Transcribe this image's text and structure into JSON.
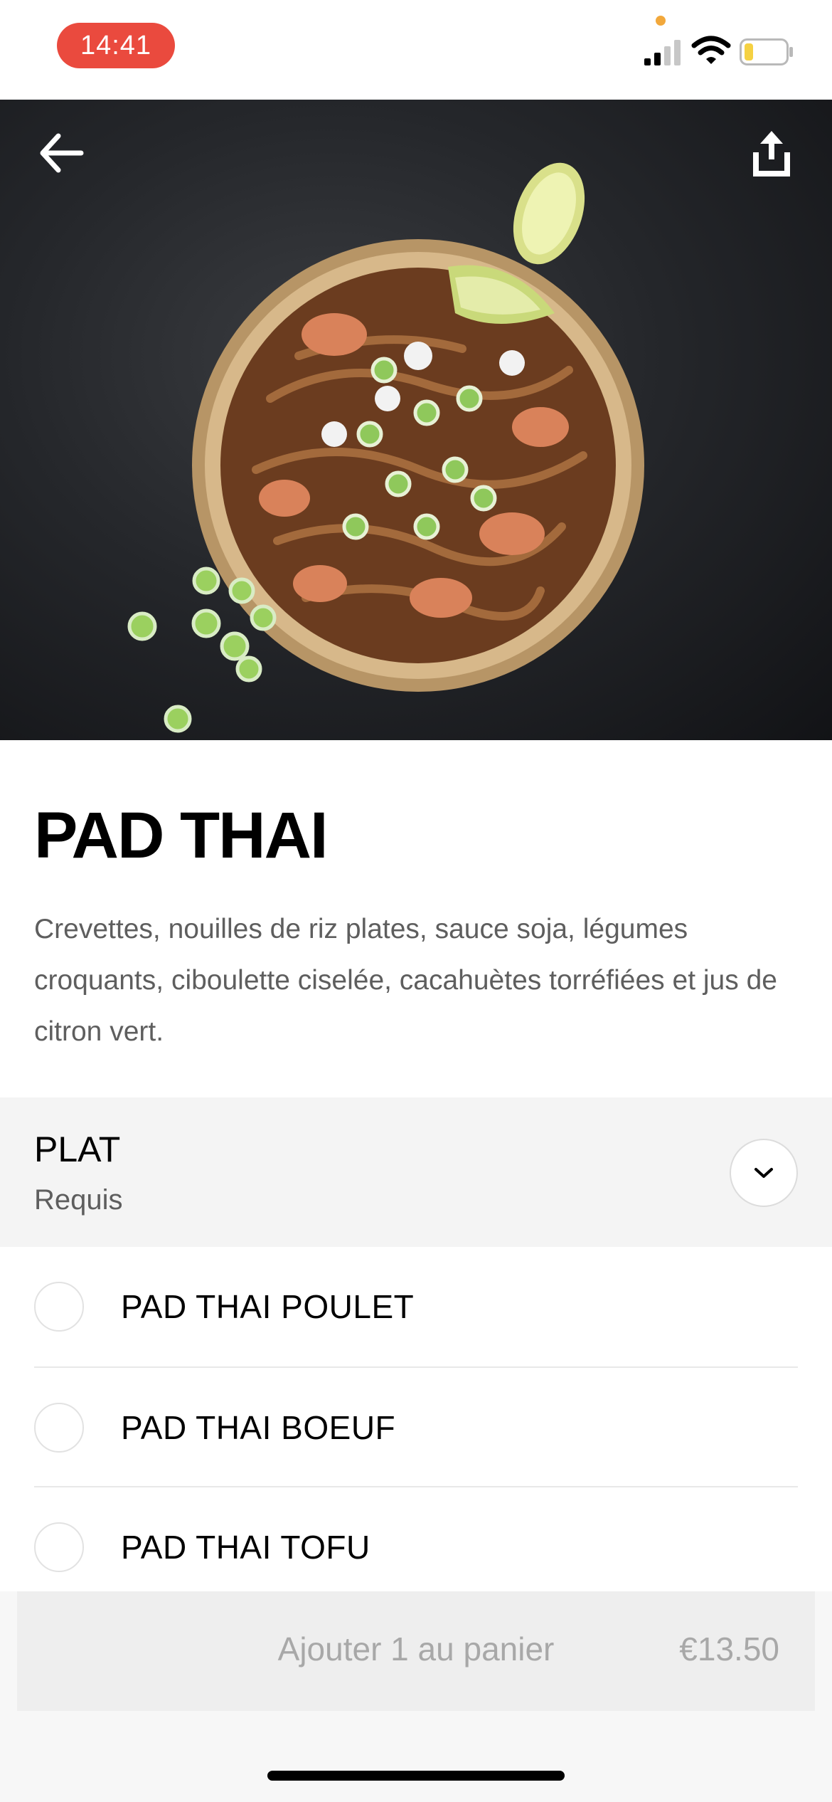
{
  "status_bar": {
    "time": "14:41",
    "icons": [
      "privacy-dot",
      "cellular-signal-icon",
      "wifi-icon",
      "battery-low-icon"
    ],
    "time_pill_color": "#ea4a3e",
    "battery_color": "#f5d142"
  },
  "hero": {
    "image": "pad-thai-bowl-photo",
    "back_icon": "arrow-left-icon",
    "share_icon": "share-icon"
  },
  "item": {
    "title": "PAD THAI",
    "description": "Crevettes, nouilles de riz plates, sauce soja, légumes croquants, ciboulette ciselée, cacahuètes torréfiées et jus de citron vert."
  },
  "section": {
    "title": "PLAT",
    "subtitle": "Requis",
    "toggle_icon": "chevron-down-icon"
  },
  "options": [
    {
      "label": "PAD THAI POULET",
      "selected": false
    },
    {
      "label": "PAD THAI BOEUF",
      "selected": false
    },
    {
      "label": "PAD THAI TOFU",
      "selected": false
    }
  ],
  "cart_button": {
    "label": "Ajouter 1 au panier",
    "price": "€13.50",
    "disabled": true
  }
}
